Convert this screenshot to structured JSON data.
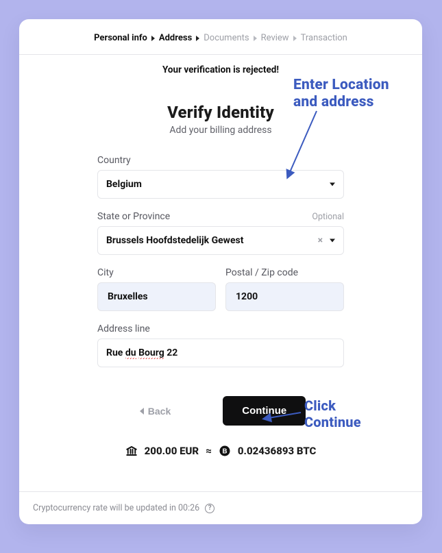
{
  "breadcrumb": {
    "items": [
      {
        "label": "Personal info",
        "state": "done"
      },
      {
        "label": "Address",
        "state": "active"
      },
      {
        "label": "Documents",
        "state": "future"
      },
      {
        "label": "Review",
        "state": "future"
      },
      {
        "label": "Transaction",
        "state": "future"
      }
    ]
  },
  "alert": {
    "text": "Your verification is rejected!"
  },
  "header": {
    "title": "Verify Identity",
    "subtitle": "Add your billing address"
  },
  "form": {
    "country": {
      "label": "Country",
      "value": "Belgium"
    },
    "state": {
      "label": "State or Province",
      "optional": "Optional",
      "value": "Brussels Hoofdstedelijk Gewest"
    },
    "city": {
      "label": "City",
      "value": "Bruxelles"
    },
    "postal": {
      "label": "Postal / Zip code",
      "value": "1200"
    },
    "address": {
      "label": "Address line",
      "value_pre": "Rue ",
      "value_mis1": "du",
      "value_mid": " ",
      "value_mis2": "Bourg",
      "value_post": " 22"
    }
  },
  "actions": {
    "back": "Back",
    "continue": "Continue"
  },
  "conversion": {
    "fiat_amount": "200.00 EUR",
    "approx": "≈",
    "crypto_amount": "0.02436893 BTC"
  },
  "footer": {
    "rate_prefix": "Cryptocurrency rate will be updated in ",
    "countdown": "00:26"
  },
  "annotations": {
    "a1_line1": "Enter Location",
    "a1_line2": "and address",
    "a2_line1": "Click",
    "a2_line2": "Continue"
  }
}
